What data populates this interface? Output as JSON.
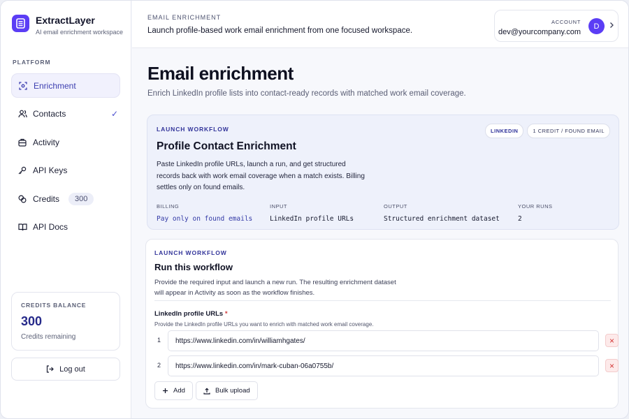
{
  "brand": {
    "name": "ExtractLayer",
    "tagline": "AI email enrichment workspace"
  },
  "sidebar": {
    "section_label": "PLATFORM",
    "items": [
      {
        "label": "Enrichment",
        "icon": "scan-icon",
        "active": true
      },
      {
        "label": "Contacts",
        "icon": "users-icon",
        "check": "✓"
      },
      {
        "label": "Activity",
        "icon": "briefcase-icon"
      },
      {
        "label": "API Keys",
        "icon": "key-icon"
      },
      {
        "label": "Credits",
        "icon": "coins-icon",
        "pill": "300"
      },
      {
        "label": "API Docs",
        "icon": "book-icon"
      }
    ],
    "balance": {
      "label": "CREDITS BALANCE",
      "value": "300",
      "sub": "Credits remaining"
    },
    "logout_label": "Log out"
  },
  "header": {
    "eyebrow": "EMAIL ENRICHMENT",
    "title": "Launch profile-based work email enrichment from one focused workspace.",
    "account": {
      "label": "ACCOUNT",
      "email": "dev@yourcompany.com",
      "avatar_initial": "D"
    }
  },
  "main": {
    "title": "Email enrichment",
    "subtitle": "Enrich LinkedIn profile lists into contact-ready records with matched work email coverage."
  },
  "workflow": {
    "eyebrow": "LAUNCH WORKFLOW",
    "badges": [
      "LINKEDIN",
      "1 CREDIT / FOUND EMAIL"
    ],
    "title": "Profile Contact Enrichment",
    "description": "Paste LinkedIn profile URLs, launch a run, and get structured records back with work email coverage when a match exists. Billing settles only on found emails.",
    "meta": [
      {
        "label": "BILLING",
        "value": "Pay only on found emails"
      },
      {
        "label": "INPUT",
        "value": "LinkedIn profile URLs"
      },
      {
        "label": "OUTPUT",
        "value": "Structured enrichment dataset"
      },
      {
        "label": "YOUR RUNS",
        "value": "2"
      }
    ]
  },
  "run": {
    "eyebrow": "LAUNCH WORKFLOW",
    "title": "Run this workflow",
    "description": "Provide the required input and launch a new run. The resulting enrichment dataset will appear in Activity as soon as the workflow finishes.",
    "field_label": "LinkedIn profile URLs",
    "required_mark": "*",
    "field_help": "Provide the LinkedIn profile URLs you want to enrich with matched work email coverage.",
    "urls": [
      {
        "index": "1",
        "value": "https://www.linkedin.com/in/williamhgates/"
      },
      {
        "index": "2",
        "value": "https://www.linkedin.com/in/mark-cuban-06a0755b/"
      }
    ],
    "add_label": "Add",
    "bulk_label": "Bulk upload",
    "remove_glyph": "×"
  },
  "colors": {
    "accent": "#5b3df5",
    "accent_text": "#3239a6",
    "danger": "#d23535"
  }
}
